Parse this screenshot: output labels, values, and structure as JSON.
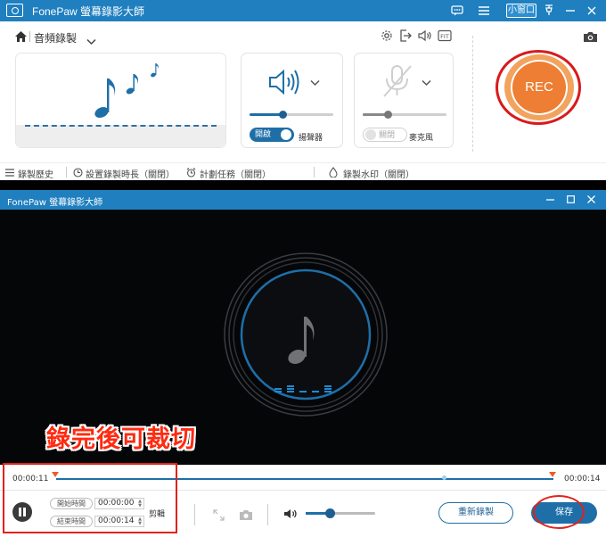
{
  "top_window": {
    "title": "FonePaw 螢幕錄影大師",
    "mini_button": "小窗口",
    "mode": {
      "label": "音頻錄製"
    },
    "system_audio": {
      "toggle": "開啟",
      "label": "揚聲器",
      "volume_pct": 40
    },
    "microphone": {
      "toggle": "關閉",
      "label": "麥克風",
      "volume_pct": 30,
      "muted": true
    },
    "rec_button": "REC",
    "toolbar": {
      "history": "錄製歷史",
      "duration": "設置錄製時長（關閉）",
      "schedule": "計劃任務（關閉）",
      "watermark": "錄製水印（關閉）"
    }
  },
  "bottom_window": {
    "title": "FonePaw 螢幕錄影大師",
    "callout": "錄完後可裁切",
    "timeline": {
      "current": "00:00:11",
      "total": "00:00:14",
      "playhead_pct": 78
    },
    "trim": {
      "start_label": "開始時間",
      "start_value": "00:00:00",
      "end_label": "結束時間",
      "end_value": "00:00:14",
      "cut_label": "剪輯"
    },
    "volume_pct": 35,
    "rerecord_button": "重新錄製",
    "save_button": "保存"
  },
  "colors": {
    "titlebar": "#1f7fbf",
    "accent": "#1e6fa8",
    "rec": "#ed7e33",
    "highlight": "#e0221a"
  }
}
